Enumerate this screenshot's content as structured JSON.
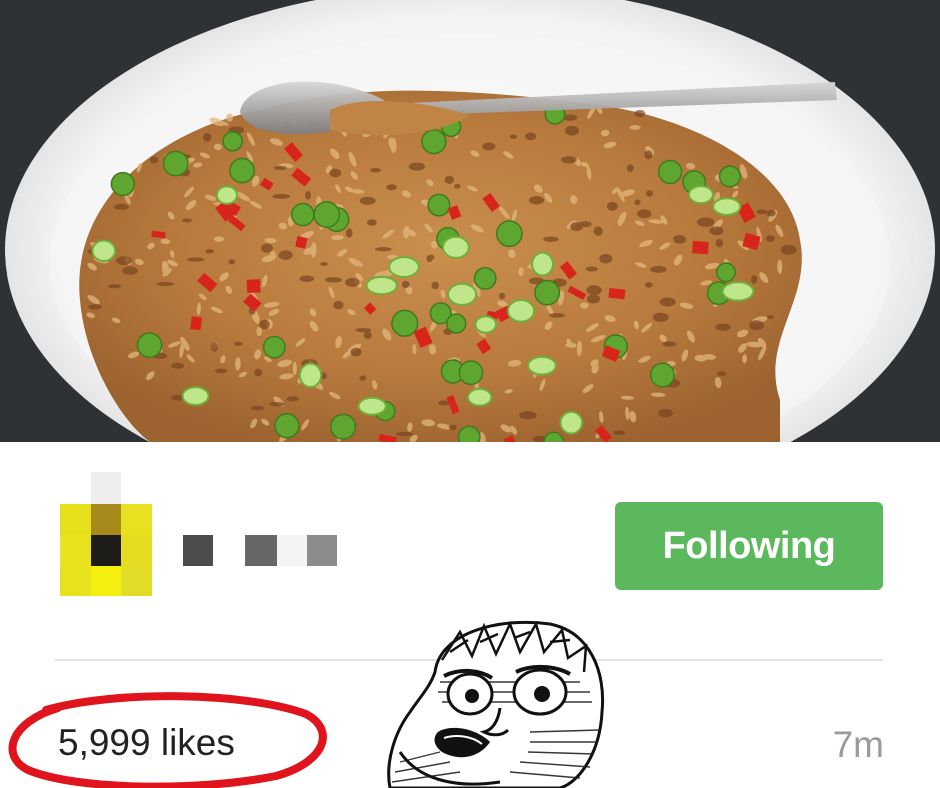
{
  "post": {
    "photo": {
      "subject": "fried-rice-dish-photo"
    },
    "author": {
      "avatar_style": "pixelated"
    },
    "follow_button": {
      "label": "Following",
      "color": "#5cb85c"
    },
    "stats": {
      "likes_label": "5,999 likes",
      "timestamp": "7m"
    },
    "annotations": {
      "circle_color": "#e0141c",
      "sticker": "rage-face-sticker"
    }
  }
}
